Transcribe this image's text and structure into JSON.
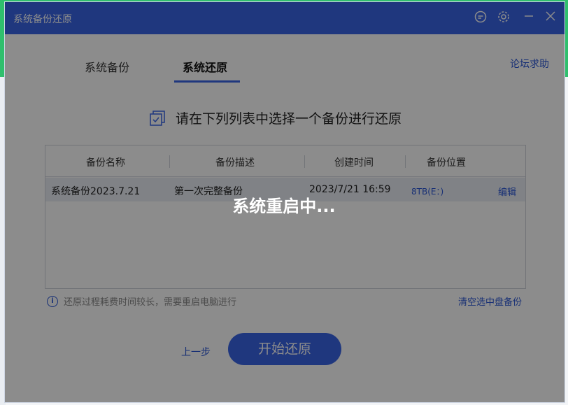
{
  "window": {
    "title": "系统备份还原"
  },
  "tabs": [
    {
      "label": "系统备份",
      "active": false
    },
    {
      "label": "系统还原",
      "active": true
    }
  ],
  "help_link": "论坛求助",
  "prompt": "请在下列列表中选择一个备份进行还原",
  "table": {
    "headers": [
      "备份名称",
      "备份描述",
      "创建时间",
      "备份位置"
    ],
    "rows": [
      {
        "name": "系统备份2023.7.21",
        "description": "第一次完整备份",
        "created": "2023/7/21 16:59",
        "location": "8TB(E：)",
        "action": "编辑"
      }
    ]
  },
  "note": "还原过程耗费时间较长，需要重启电脑进行",
  "clear_link": "清空选中盘备份",
  "buttons": {
    "prev": "上一步",
    "start": "开始还原"
  },
  "overlay_text": "系统重启中...",
  "colors": {
    "accent": "#3a64e6",
    "link": "#2a56d6",
    "overlay": "rgba(0,0,0,0.45)"
  },
  "icons": [
    "feedback-icon",
    "settings-gear-icon",
    "minimize-icon",
    "close-icon",
    "checklist-icon",
    "info-icon"
  ]
}
